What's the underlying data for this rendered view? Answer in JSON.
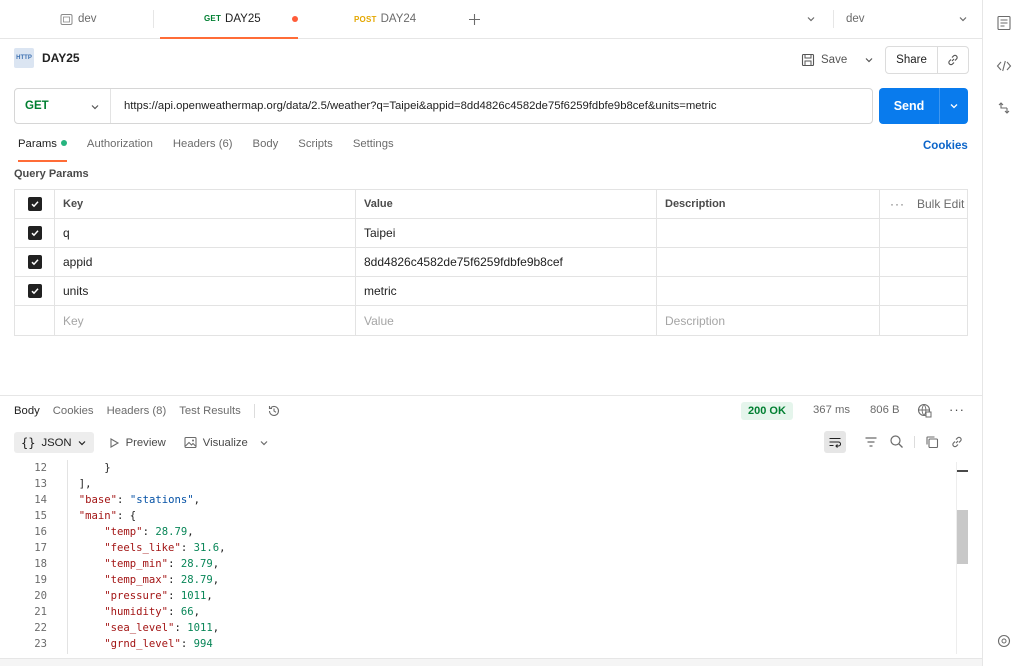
{
  "tabs": {
    "env_left": "dev",
    "items": [
      {
        "method": "GET",
        "name": "DAY25",
        "color": "#ff6c37"
      },
      {
        "method": "POST",
        "name": "DAY24",
        "color": "#e4a700"
      }
    ],
    "env_right": "dev"
  },
  "request": {
    "badge": "HTTP",
    "name": "DAY25",
    "save_label": "Save",
    "share_label": "Share",
    "method": "GET",
    "url": "https://api.openweathermap.org/data/2.5/weather?q=Taipei&appid=8dd4826c4582de75f6259fdbfe9b8cef&units=metric",
    "send_label": "Send"
  },
  "req_tabs": {
    "params": "Params",
    "authorization": "Authorization",
    "headers": "Headers (6)",
    "body": "Body",
    "scripts": "Scripts",
    "settings": "Settings",
    "cookies": "Cookies"
  },
  "query_params": {
    "title": "Query Params",
    "headers": {
      "key": "Key",
      "value": "Value",
      "description": "Description",
      "bulk_edit": "Bulk Edit"
    },
    "rows": [
      {
        "key": "q",
        "value": "Taipei"
      },
      {
        "key": "appid",
        "value": "8dd4826c4582de75f6259fdbfe9b8cef"
      },
      {
        "key": "units",
        "value": "metric"
      }
    ],
    "placeholder": {
      "key": "Key",
      "value": "Value",
      "description": "Description"
    }
  },
  "response": {
    "tabs": {
      "body": "Body",
      "cookies": "Cookies",
      "headers": "Headers (8)",
      "test_results": "Test Results"
    },
    "status": "200 OK",
    "time": "367 ms",
    "size": "806 B",
    "format": "JSON",
    "preview": "Preview",
    "visualize": "Visualize"
  },
  "code_lines": [
    {
      "num": "12",
      "indent": "      ",
      "parts": [
        {
          "t": "}",
          "c": "p"
        }
      ]
    },
    {
      "num": "13",
      "indent": "  ",
      "parts": [
        {
          "t": "],",
          "c": "p"
        }
      ]
    },
    {
      "num": "14",
      "indent": "  ",
      "parts": [
        {
          "t": "\"base\"",
          "c": "k"
        },
        {
          "t": ": ",
          "c": "p"
        },
        {
          "t": "\"stations\"",
          "c": "s"
        },
        {
          "t": ",",
          "c": "p"
        }
      ]
    },
    {
      "num": "15",
      "indent": "  ",
      "parts": [
        {
          "t": "\"main\"",
          "c": "k"
        },
        {
          "t": ": {",
          "c": "p"
        }
      ]
    },
    {
      "num": "16",
      "indent": "      ",
      "parts": [
        {
          "t": "\"temp\"",
          "c": "k"
        },
        {
          "t": ": ",
          "c": "p"
        },
        {
          "t": "28.79",
          "c": "n"
        },
        {
          "t": ",",
          "c": "p"
        }
      ]
    },
    {
      "num": "17",
      "indent": "      ",
      "parts": [
        {
          "t": "\"feels_like\"",
          "c": "k"
        },
        {
          "t": ": ",
          "c": "p"
        },
        {
          "t": "31.6",
          "c": "n"
        },
        {
          "t": ",",
          "c": "p"
        }
      ]
    },
    {
      "num": "18",
      "indent": "      ",
      "parts": [
        {
          "t": "\"temp_min\"",
          "c": "k"
        },
        {
          "t": ": ",
          "c": "p"
        },
        {
          "t": "28.79",
          "c": "n"
        },
        {
          "t": ",",
          "c": "p"
        }
      ]
    },
    {
      "num": "19",
      "indent": "      ",
      "parts": [
        {
          "t": "\"temp_max\"",
          "c": "k"
        },
        {
          "t": ": ",
          "c": "p"
        },
        {
          "t": "28.79",
          "c": "n"
        },
        {
          "t": ",",
          "c": "p"
        }
      ]
    },
    {
      "num": "20",
      "indent": "      ",
      "parts": [
        {
          "t": "\"pressure\"",
          "c": "k"
        },
        {
          "t": ": ",
          "c": "p"
        },
        {
          "t": "1011",
          "c": "n"
        },
        {
          "t": ",",
          "c": "p"
        }
      ]
    },
    {
      "num": "21",
      "indent": "      ",
      "parts": [
        {
          "t": "\"humidity\"",
          "c": "k"
        },
        {
          "t": ": ",
          "c": "p"
        },
        {
          "t": "66",
          "c": "n"
        },
        {
          "t": ",",
          "c": "p"
        }
      ]
    },
    {
      "num": "22",
      "indent": "      ",
      "parts": [
        {
          "t": "\"sea_level\"",
          "c": "k"
        },
        {
          "t": ": ",
          "c": "p"
        },
        {
          "t": "1011",
          "c": "n"
        },
        {
          "t": ",",
          "c": "p"
        }
      ]
    },
    {
      "num": "23",
      "indent": "      ",
      "parts": [
        {
          "t": "\"grnd_level\"",
          "c": "k"
        },
        {
          "t": ": ",
          "c": "p"
        },
        {
          "t": "994",
          "c": "n"
        }
      ]
    }
  ]
}
